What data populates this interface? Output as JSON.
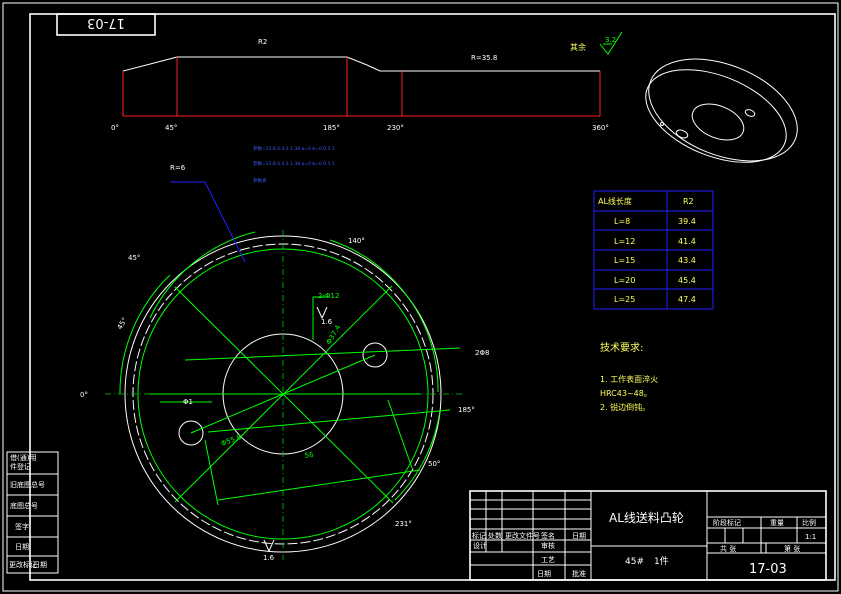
{
  "title_tag": "17-03",
  "cam_profile": {
    "radius_label": "R2",
    "radius_value_label": "R=35.8",
    "x_ticks": [
      "0°",
      "45°",
      "185°",
      "230°",
      "360°"
    ],
    "roughness_value": "3.2",
    "roughness_note": "其余"
  },
  "blue_notes": [
    "参数=15.8 0.4 3 1.38 a=0 b=0 0.5 1",
    "参数=15.8 0.4 3 1.38 a=0 b=0 0.5 1",
    "参数表"
  ],
  "main_view": {
    "angle_labels": [
      "45°",
      "45°",
      "0°",
      "140°",
      "185°",
      "50°",
      "231°"
    ],
    "dim_labels": [
      "R=6",
      "2-Φ12",
      "Φ37.4",
      "2Φ8",
      "Φ1",
      "Φ55.8",
      "56"
    ],
    "flatness_labels": [
      "1.6",
      "1.6"
    ]
  },
  "r2_table": {
    "headers": [
      "AL线长度",
      "R2"
    ],
    "rows": [
      [
        "L=8",
        "39.4"
      ],
      [
        "L=12",
        "41.4"
      ],
      [
        "L=15",
        "43.4"
      ],
      [
        "L=20",
        "45.4"
      ],
      [
        "L=25",
        "47.4"
      ]
    ]
  },
  "tech_requirements": {
    "heading": "技术要求:",
    "items": [
      "1. 工作表面淬火",
      "HRC43~48。",
      "2. 锐边倒钝。"
    ]
  },
  "title_block": {
    "part_name": "AL线送料凸轮",
    "material": "45#",
    "quantity": "1件",
    "drawing_number": "17-03",
    "scale": "1:1",
    "labels_right": [
      "阶段标记",
      "重量",
      "比例"
    ],
    "labels_bottom_right": [
      "共 张",
      "第 张"
    ],
    "labels_left": [
      "标记",
      "处数",
      "更改文件号",
      "签名",
      "日期",
      "设计",
      "审核",
      "工艺",
      "日期",
      "批准"
    ]
  },
  "left_strip": [
    "借(通)用",
    "件登记",
    "旧底图总号",
    "底图总号",
    "签字",
    "日期",
    "更改标记",
    "日期"
  ]
}
